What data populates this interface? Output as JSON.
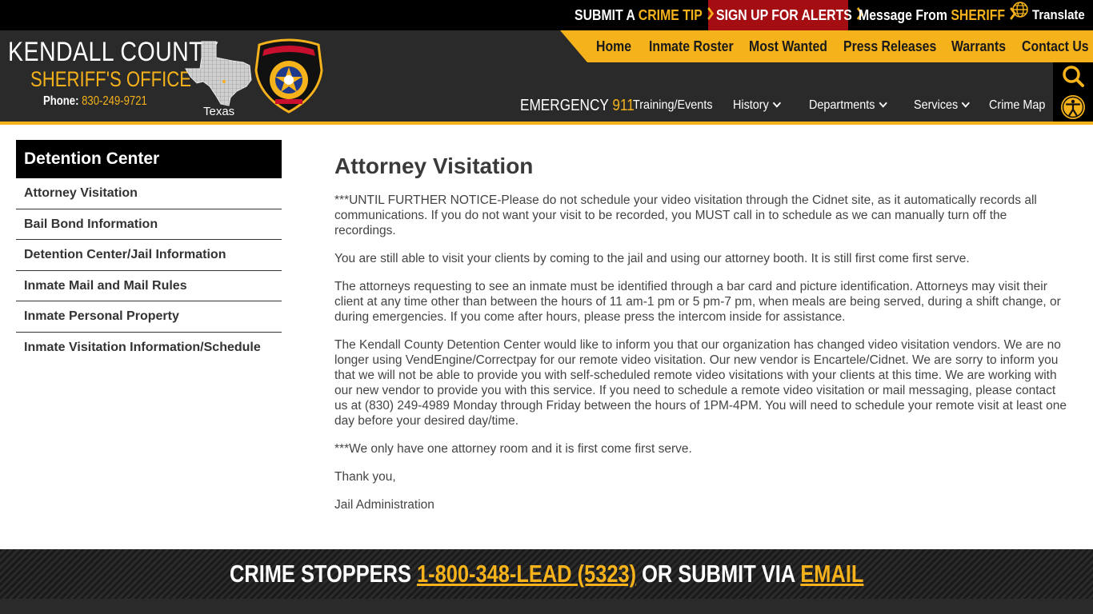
{
  "topbar": {
    "tip_prefix": "SUBMIT A ",
    "tip_highlight": "CRIME TIP",
    "alerts_label": "SIGN UP FOR ALERTS",
    "msg_prefix": "Message From ",
    "msg_highlight": "SHERIFF",
    "translate_label": "Translate"
  },
  "brand": {
    "line1": "KENDALL COUNTY",
    "line2": "SHERIFF'S OFFICE",
    "phone_label": "Phone:",
    "phone_number": "830-249-9721",
    "state_label": "Texas"
  },
  "nav": {
    "primary": [
      "Home",
      "Inmate Roster",
      "Most Wanted",
      "Press Releases",
      "Warrants",
      "Contact Us"
    ],
    "emergency_label": "EMERGENCY",
    "emergency_number": "911",
    "secondary": [
      "Training/Events",
      "History",
      "Departments",
      "Services",
      "Crime Map"
    ]
  },
  "sidebar": {
    "title": "Detention Center",
    "items": [
      "Attorney Visitation",
      "Bail Bond Information",
      "Detention Center/Jail Information",
      "Inmate Mail and Mail Rules",
      "Inmate Personal Property",
      "Inmate Visitation Information/Schedule"
    ]
  },
  "main": {
    "title": "Attorney Visitation",
    "paragraphs": [
      "***UNTIL FURTHER NOTICE-Please do not schedule your video visitation through the Cidnet site, as it automatically records all communications.  If you do not want your visit to be recorded, you MUST call in to schedule as we can manually turn off the recordings.",
      "You are still able to visit your clients by coming to the jail and using our attorney booth.  It is still first come first serve.",
      "The attorneys requesting to see an inmate must be identified through a bar card and picture identification.  Attorneys may visit their client at any time other than between the hours of 11 am-1 pm or 5 pm-7 pm, when meals are being served, during a shift change, or during emergencies. If you come after hours, please press the intercom inside for assistance.",
      "The Kendall County Detention Center would like to inform you that our organization has changed video visitation vendors.  We are no longer using VendEngine/Correctpay for our remote video visitation.   Our new vendor is Encartele/Cidnet.  We are sorry to inform you that we will not be able to provide you with self-scheduled remote video visitations with your clients at this time.  We are working with our new vendor to provide you with this service.  If you need to schedule a remote video visitation or mail messaging, please contact us at (830) 249-4989 Monday through Friday between the hours of 1PM-4PM.  You will need to schedule your remote visit at least one day before your desired day/time.",
      "***We only have one attorney room and it is first come first serve.",
      "Thank you,",
      "Jail Administration"
    ]
  },
  "footer": {
    "prefix": "CRIME STOPPERS ",
    "phone": "1-800-348-LEAD (5323)",
    "middle": " OR SUBMIT VIA ",
    "email": "EMAIL"
  },
  "colors": {
    "accent_gold": "#f5b21b",
    "alert_red": "#a40d11",
    "header_dark": "#2a2a2a"
  }
}
